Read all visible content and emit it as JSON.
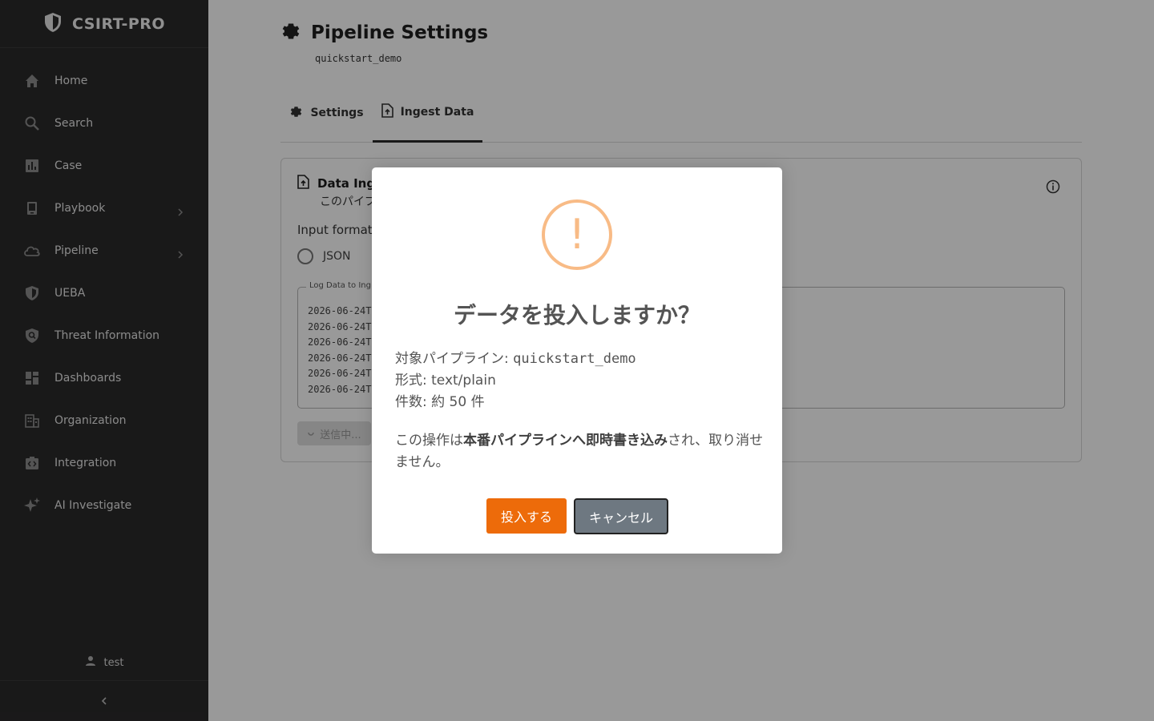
{
  "brand": {
    "name": "CSIRT-PRO"
  },
  "sidebar": {
    "items": [
      {
        "label": "Home",
        "icon": "home-icon"
      },
      {
        "label": "Search",
        "icon": "search-icon"
      },
      {
        "label": "Case",
        "icon": "bar-chart-icon"
      },
      {
        "label": "Playbook",
        "icon": "book-icon",
        "expandable": true
      },
      {
        "label": "Pipeline",
        "icon": "cloud-icon",
        "expandable": true
      },
      {
        "label": "UEBA",
        "icon": "shield-icon"
      },
      {
        "label": "Threat Information",
        "icon": "shield-search-icon"
      },
      {
        "label": "Dashboards",
        "icon": "dashboard-icon"
      },
      {
        "label": "Organization",
        "icon": "building-icon"
      },
      {
        "label": "Integration",
        "icon": "integration-icon"
      },
      {
        "label": "AI Investigate",
        "icon": "sparkle-icon"
      }
    ],
    "user": "test"
  },
  "page": {
    "title": "Pipeline Settings",
    "subtitle": "quickstart_demo"
  },
  "tabs": [
    {
      "label": "Settings",
      "icon": "gear-icon",
      "active": false
    },
    {
      "label": "Ingest Data",
      "icon": "file-upload-icon",
      "active": true
    }
  ],
  "card": {
    "title": "Data Ing",
    "description": "このパイプ",
    "input_format_label": "Input format",
    "radio_json": "JSON",
    "log_legend": "Log Data to Ing",
    "log_lines": [
      "2026-06-24T",
      "2026-06-24T",
      "2026-06-24T",
      "2026-06-24T",
      "2026-06-24T",
      "2026-06-24T"
    ],
    "submit_label": "送信中..."
  },
  "modal": {
    "title": "データを投入しますか？",
    "pipeline_label": "対象パイプライン: ",
    "pipeline_value": "quickstart_demo",
    "format_line": "形式: text/plain",
    "count_line": "件数: 約 50 件",
    "warning_pre": "この操作は",
    "warning_bold": "本番パイプラインへ即時書き込み",
    "warning_post": "され、取り消せません。",
    "confirm_label": "投入する",
    "cancel_label": "キャンセル",
    "warning_color": "#f8bb86",
    "confirm_color": "#ed6b0a"
  }
}
